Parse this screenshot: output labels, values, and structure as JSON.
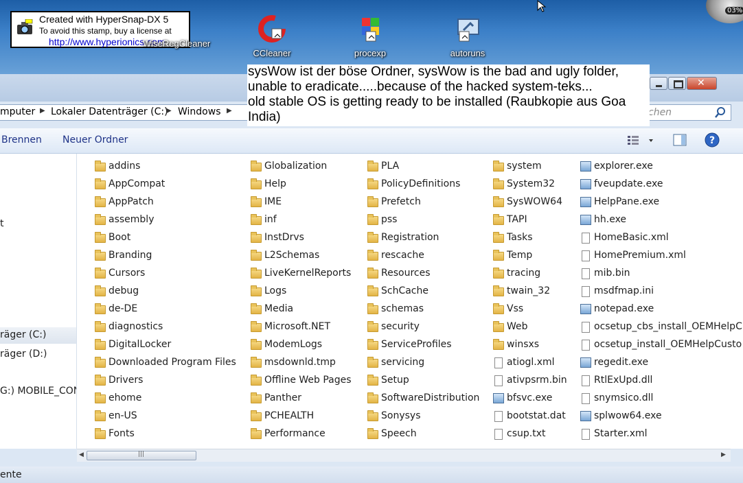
{
  "stamp": {
    "line1": "Created with HyperSnap-DX 5",
    "line2": "To avoid this stamp, buy a license at",
    "link": "http://www.hyperionics.com"
  },
  "desktop_icons": [
    {
      "label": "WiseRegCleaner",
      "icon": "wiseregcleaner-icon"
    },
    {
      "label": "CCleaner",
      "icon": "ccleaner-icon"
    },
    {
      "label": "procexp",
      "icon": "procexp-icon"
    },
    {
      "label": "autoruns",
      "icon": "autoruns-icon"
    }
  ],
  "gadget": {
    "value": "03%"
  },
  "overlay_note": {
    "lines": [
      "sysWow ist der böse Ordner, sysWow is the bad and ugly folder,",
      "unable to eradicate.....because of the hacked system-teks...",
      "old stable OS is getting ready to be installed (Raubkopie aus Goa",
      "India)"
    ]
  },
  "address_bar": {
    "crumbs": [
      "mputer",
      "Lokaler Datenträger (C:)",
      "Windows"
    ]
  },
  "search": {
    "placeholder": "chen"
  },
  "toolbar": {
    "burn_label": "Brennen",
    "new_folder_label": "Neuer Ordner"
  },
  "nav_pane": {
    "items": [
      "t",
      "räger (C:)",
      "räger (D:)",
      "G:) MOBILE_CONT"
    ]
  },
  "columns": [
    [
      {
        "name": "addins",
        "type": "folder"
      },
      {
        "name": "AppCompat",
        "type": "folder"
      },
      {
        "name": "AppPatch",
        "type": "folder"
      },
      {
        "name": "assembly",
        "type": "folder"
      },
      {
        "name": "Boot",
        "type": "folder"
      },
      {
        "name": "Branding",
        "type": "folder"
      },
      {
        "name": "Cursors",
        "type": "folder"
      },
      {
        "name": "debug",
        "type": "folder"
      },
      {
        "name": "de-DE",
        "type": "folder"
      },
      {
        "name": "diagnostics",
        "type": "folder"
      },
      {
        "name": "DigitalLocker",
        "type": "folder"
      },
      {
        "name": "Downloaded Program Files",
        "type": "folder"
      },
      {
        "name": "Drivers",
        "type": "folder"
      },
      {
        "name": "ehome",
        "type": "folder"
      },
      {
        "name": "en-US",
        "type": "folder"
      },
      {
        "name": "Fonts",
        "type": "folder"
      }
    ],
    [
      {
        "name": "Globalization",
        "type": "folder"
      },
      {
        "name": "Help",
        "type": "folder"
      },
      {
        "name": "IME",
        "type": "folder"
      },
      {
        "name": "inf",
        "type": "folder"
      },
      {
        "name": "InstDrvs",
        "type": "folder"
      },
      {
        "name": "L2Schemas",
        "type": "folder"
      },
      {
        "name": "LiveKernelReports",
        "type": "folder"
      },
      {
        "name": "Logs",
        "type": "folder"
      },
      {
        "name": "Media",
        "type": "folder"
      },
      {
        "name": "Microsoft.NET",
        "type": "folder"
      },
      {
        "name": "ModemLogs",
        "type": "folder"
      },
      {
        "name": "msdownld.tmp",
        "type": "folder"
      },
      {
        "name": "Offline Web Pages",
        "type": "folder"
      },
      {
        "name": "Panther",
        "type": "folder"
      },
      {
        "name": "PCHEALTH",
        "type": "folder"
      },
      {
        "name": "Performance",
        "type": "folder"
      }
    ],
    [
      {
        "name": "PLA",
        "type": "folder"
      },
      {
        "name": "PolicyDefinitions",
        "type": "folder"
      },
      {
        "name": "Prefetch",
        "type": "folder"
      },
      {
        "name": "pss",
        "type": "folder"
      },
      {
        "name": "Registration",
        "type": "folder"
      },
      {
        "name": "rescache",
        "type": "folder"
      },
      {
        "name": "Resources",
        "type": "folder"
      },
      {
        "name": "SchCache",
        "type": "folder"
      },
      {
        "name": "schemas",
        "type": "folder"
      },
      {
        "name": "security",
        "type": "folder"
      },
      {
        "name": "ServiceProfiles",
        "type": "folder"
      },
      {
        "name": "servicing",
        "type": "folder"
      },
      {
        "name": "Setup",
        "type": "folder"
      },
      {
        "name": "SoftwareDistribution",
        "type": "folder"
      },
      {
        "name": "Sonysys",
        "type": "folder"
      },
      {
        "name": "Speech",
        "type": "folder"
      }
    ],
    [
      {
        "name": "system",
        "type": "folder"
      },
      {
        "name": "System32",
        "type": "folder"
      },
      {
        "name": "SysWOW64",
        "type": "folder"
      },
      {
        "name": "TAPI",
        "type": "folder"
      },
      {
        "name": "Tasks",
        "type": "folder"
      },
      {
        "name": "Temp",
        "type": "folder"
      },
      {
        "name": "tracing",
        "type": "folder"
      },
      {
        "name": "twain_32",
        "type": "folder"
      },
      {
        "name": "Vss",
        "type": "folder"
      },
      {
        "name": "Web",
        "type": "folder"
      },
      {
        "name": "winsxs",
        "type": "folder"
      },
      {
        "name": "atiogl.xml",
        "type": "file"
      },
      {
        "name": "ativpsrm.bin",
        "type": "file"
      },
      {
        "name": "bfsvc.exe",
        "type": "exe"
      },
      {
        "name": "bootstat.dat",
        "type": "file"
      },
      {
        "name": "csup.txt",
        "type": "file"
      }
    ],
    [
      {
        "name": "explorer.exe",
        "type": "exe"
      },
      {
        "name": "fveupdate.exe",
        "type": "exe"
      },
      {
        "name": "HelpPane.exe",
        "type": "exe"
      },
      {
        "name": "hh.exe",
        "type": "exe"
      },
      {
        "name": "HomeBasic.xml",
        "type": "file"
      },
      {
        "name": "HomePremium.xml",
        "type": "file"
      },
      {
        "name": "mib.bin",
        "type": "file"
      },
      {
        "name": "msdfmap.ini",
        "type": "file"
      },
      {
        "name": "notepad.exe",
        "type": "exe"
      },
      {
        "name": "ocsetup_cbs_install_OEMHelpC",
        "type": "file"
      },
      {
        "name": "ocsetup_install_OEMHelpCusto",
        "type": "file"
      },
      {
        "name": "regedit.exe",
        "type": "exe"
      },
      {
        "name": "RtlExUpd.dll",
        "type": "file"
      },
      {
        "name": "snymsico.dll",
        "type": "file"
      },
      {
        "name": "splwow64.exe",
        "type": "exe"
      },
      {
        "name": "Starter.xml",
        "type": "file"
      }
    ]
  ],
  "status_bar": {
    "text": "ente"
  },
  "colors": {
    "toolbar_text": "#1e3287",
    "link": "#0000cc",
    "folder": "#e3b446"
  }
}
